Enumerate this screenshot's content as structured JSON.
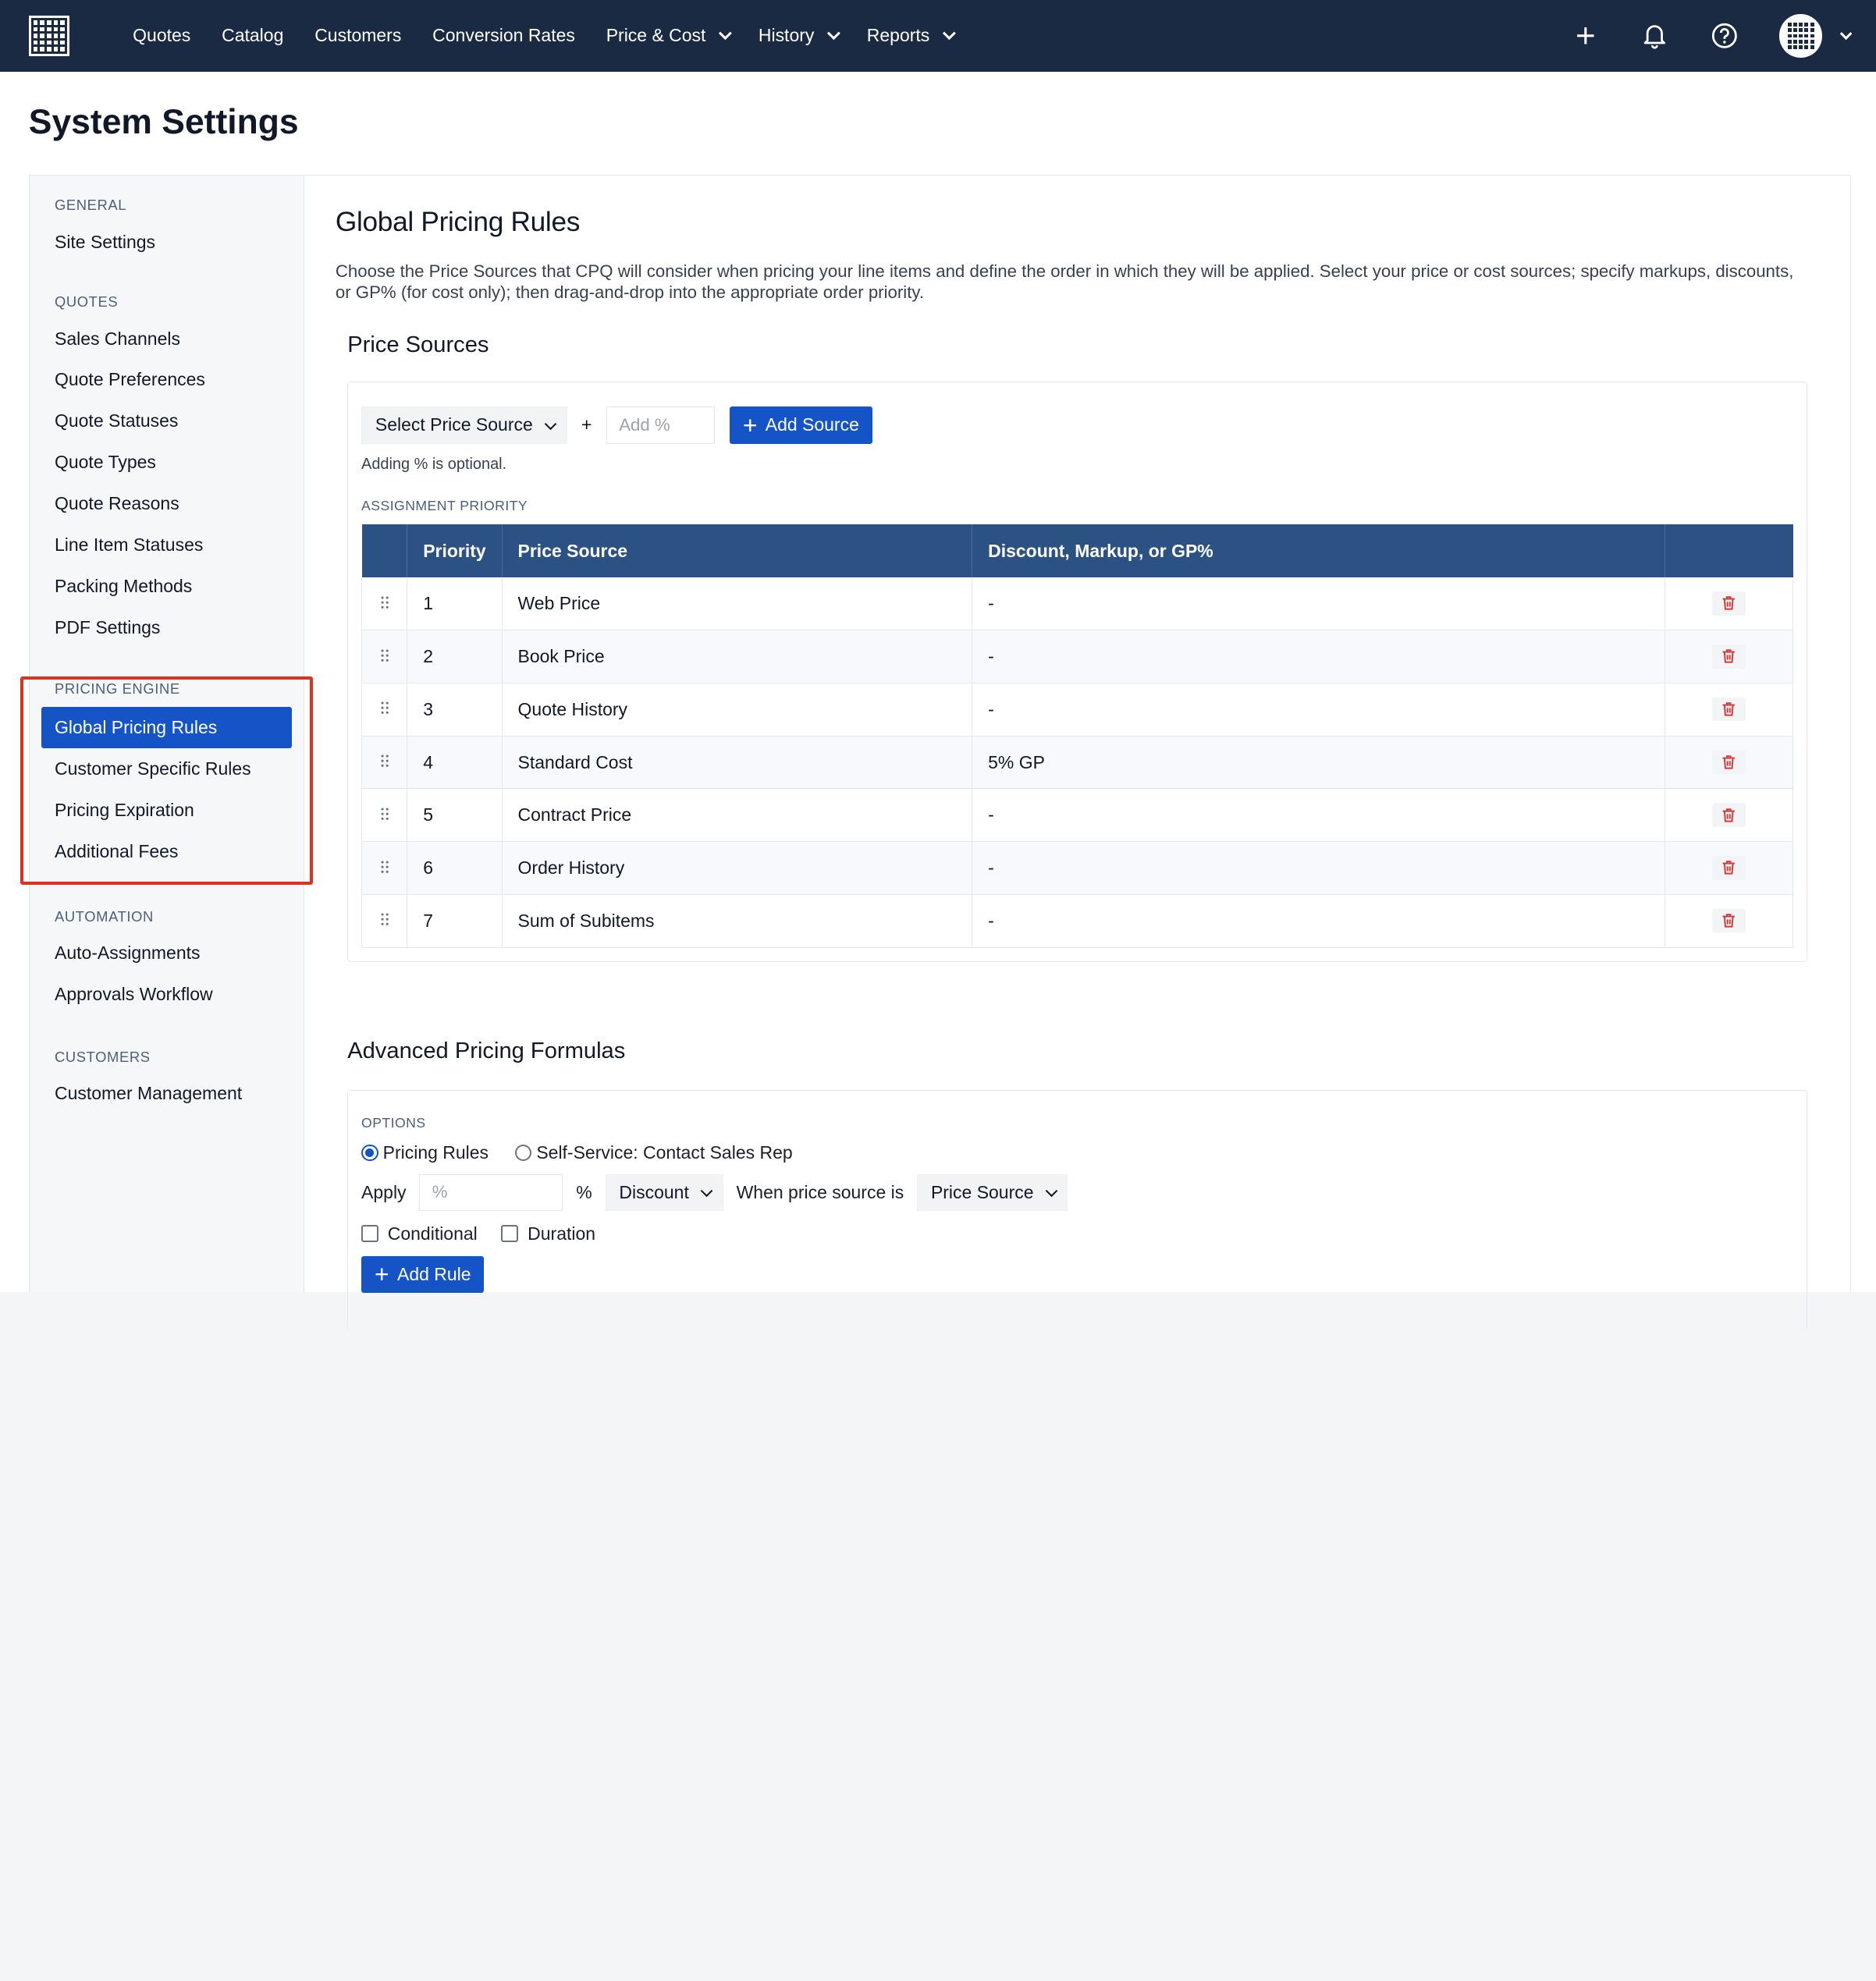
{
  "nav": {
    "links": [
      "Quotes",
      "Catalog",
      "Customers",
      "Conversion Rates"
    ],
    "dropdowns": [
      "Price & Cost",
      "History",
      "Reports"
    ]
  },
  "page": {
    "title": "System Settings"
  },
  "sidebar": {
    "groups": [
      {
        "label": "GENERAL",
        "items": [
          "Site Settings"
        ]
      },
      {
        "label": "QUOTES",
        "items": [
          "Sales Channels",
          "Quote Preferences",
          "Quote Statuses",
          "Quote Types",
          "Quote Reasons",
          "Line Item Statuses",
          "Packing Methods",
          "PDF Settings"
        ]
      },
      {
        "label": "PRICING ENGINE",
        "items": [
          "Global Pricing Rules",
          "Customer Specific Rules",
          "Pricing Expiration",
          "Additional Fees"
        ]
      },
      {
        "label": "AUTOMATION",
        "items": [
          "Auto-Assignments",
          "Approvals Workflow"
        ]
      },
      {
        "label": "CUSTOMERS",
        "items": [
          "Customer Management"
        ]
      }
    ],
    "active": "Global Pricing Rules"
  },
  "main": {
    "title": "Global Pricing Rules",
    "description": "Choose the Price Sources that CPQ will consider when pricing your line items and define the order in which they will be applied. Select your price or cost sources; specify markups, discounts, or GP% (for cost only); then drag-and-drop into the appropriate order priority.",
    "price_sources": {
      "title": "Price Sources",
      "select_label": "Select Price Source",
      "plus": "+",
      "percent_placeholder": "Add %",
      "add_button": "Add Source",
      "hint": "Adding % is optional.",
      "priority_label": "ASSIGNMENT PRIORITY",
      "columns": [
        "Priority",
        "Price Source",
        "Discount, Markup, or GP%"
      ],
      "rows": [
        {
          "priority": "1",
          "source": "Web Price",
          "adj": "-"
        },
        {
          "priority": "2",
          "source": "Book Price",
          "adj": "-"
        },
        {
          "priority": "3",
          "source": "Quote History",
          "adj": "-"
        },
        {
          "priority": "4",
          "source": "Standard Cost",
          "adj": "5% GP"
        },
        {
          "priority": "5",
          "source": "Contract Price",
          "adj": "-"
        },
        {
          "priority": "6",
          "source": "Order History",
          "adj": "-"
        },
        {
          "priority": "7",
          "source": "Sum of Subitems",
          "adj": "-"
        }
      ]
    },
    "formulas": {
      "title": "Advanced Pricing Formulas",
      "options_label": "OPTIONS",
      "radio_options": [
        "Pricing Rules",
        "Self-Service: Contact Sales Rep"
      ],
      "radio_selected": "Pricing Rules",
      "apply_label": "Apply",
      "percent_placeholder": "%",
      "percent_sign": "%",
      "discount_select": "Discount",
      "when_label": "When price source is",
      "source_select": "Price Source",
      "checkboxes": [
        "Conditional",
        "Duration"
      ],
      "add_button": "Add Rule"
    }
  },
  "colors": {
    "nav_bg": "#1b2a43",
    "primary": "#1554c6",
    "table_header": "#2c5284",
    "highlight": "#e0301e",
    "danger": "#d63a3a"
  }
}
